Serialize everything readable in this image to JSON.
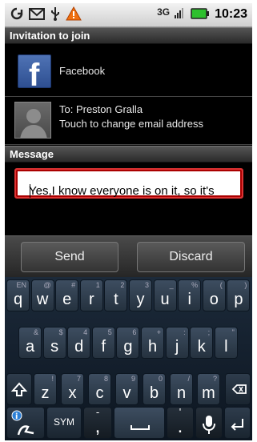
{
  "status_bar": {
    "network": "3G",
    "time": "10:23",
    "left_icons": [
      "sync-icon",
      "gmail-icon",
      "usb-icon",
      "warning-icon"
    ]
  },
  "invitation": {
    "header": "Invitation to join",
    "facebook_label": "Facebook",
    "to_label": "To: Preston Gralla",
    "change_label": "Touch to change email address"
  },
  "message": {
    "header": "Message",
    "text": "Yes,I know everyone is on it, so it's"
  },
  "actions": {
    "send": "Send",
    "discard": "Discard"
  },
  "keyboard": {
    "row1": [
      [
        "q",
        "EN"
      ],
      [
        "w",
        "@"
      ],
      [
        "e",
        "#"
      ],
      [
        "r",
        "1"
      ],
      [
        "t",
        "2"
      ],
      [
        "y",
        "3"
      ],
      [
        "u",
        "_"
      ],
      [
        "i",
        "%"
      ],
      [
        "o",
        "("
      ],
      [
        "p",
        ")"
      ]
    ],
    "row2": [
      [
        "a",
        "&"
      ],
      [
        "s",
        "$"
      ],
      [
        "d",
        "4"
      ],
      [
        "f",
        "5"
      ],
      [
        "g",
        "6"
      ],
      [
        "h",
        "+"
      ],
      [
        "j",
        ":"
      ],
      [
        "k",
        ";"
      ],
      [
        "l",
        "\""
      ]
    ],
    "row3": [
      [
        "z",
        "!"
      ],
      [
        "x",
        "7"
      ],
      [
        "c",
        "8"
      ],
      [
        "v",
        "9"
      ],
      [
        "b",
        "0"
      ],
      [
        "n",
        "/"
      ],
      [
        "m",
        "?"
      ]
    ],
    "sym": "SYM",
    "comma": ",",
    "period": "."
  }
}
